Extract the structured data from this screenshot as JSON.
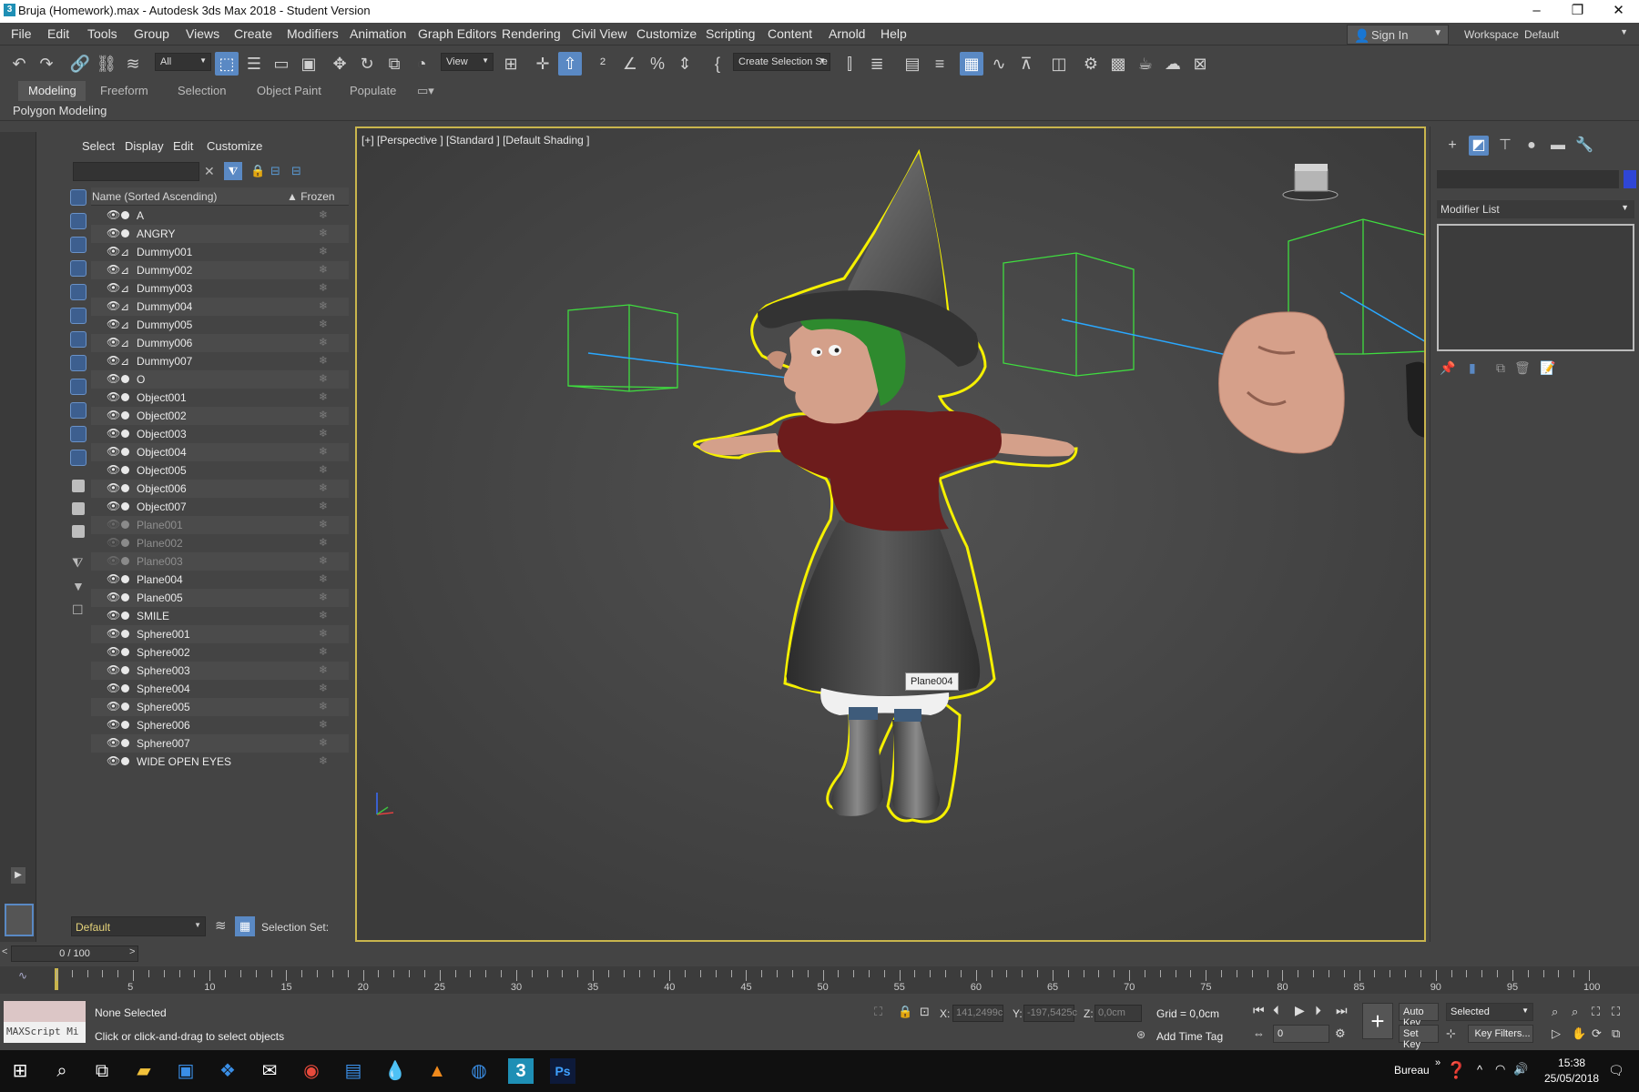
{
  "window": {
    "title": "Bruja (Homework).max - Autodesk 3ds Max 2018 - Student Version",
    "app_icon": "3",
    "controls": [
      "–",
      "❐",
      "✕"
    ]
  },
  "menubar": {
    "items": [
      "File",
      "Edit",
      "Tools",
      "Group",
      "Views",
      "Create",
      "Modifiers",
      "Animation",
      "Graph Editors",
      "Rendering",
      "Civil View",
      "Customize",
      "Scripting",
      "Content",
      "Arnold",
      "Help"
    ],
    "sign_in": "Sign In",
    "workspaces_label": "Workspaces:",
    "workspace_value": "Default"
  },
  "toolbar": {
    "filter_value": "All",
    "refcoord_value": "View",
    "selection_set_value": "Create Selection Se"
  },
  "ribbon": {
    "tabs": [
      "Modeling",
      "Freeform",
      "Selection",
      "Object Paint",
      "Populate"
    ],
    "active_tab": "Modeling",
    "sub_label": "Polygon Modeling"
  },
  "scene_explorer": {
    "menus": [
      "Select",
      "Display",
      "Edit",
      "Customize"
    ],
    "column_name": "Name (Sorted Ascending)",
    "column_frozen": "▲ Frozen",
    "rows": [
      {
        "name": "A",
        "type": "object",
        "dim": false
      },
      {
        "name": "ANGRY",
        "type": "object",
        "dim": false
      },
      {
        "name": "Dummy001",
        "type": "dummy",
        "dim": false
      },
      {
        "name": "Dummy002",
        "type": "dummy",
        "dim": false
      },
      {
        "name": "Dummy003",
        "type": "dummy",
        "dim": false
      },
      {
        "name": "Dummy004",
        "type": "dummy",
        "dim": false
      },
      {
        "name": "Dummy005",
        "type": "dummy",
        "dim": false
      },
      {
        "name": "Dummy006",
        "type": "dummy",
        "dim": false
      },
      {
        "name": "Dummy007",
        "type": "dummy",
        "dim": false
      },
      {
        "name": "O",
        "type": "object",
        "dim": false
      },
      {
        "name": "Object001",
        "type": "object",
        "dim": false
      },
      {
        "name": "Object002",
        "type": "object",
        "dim": false
      },
      {
        "name": "Object003",
        "type": "object",
        "dim": false
      },
      {
        "name": "Object004",
        "type": "object",
        "dim": false
      },
      {
        "name": "Object005",
        "type": "object",
        "dim": false
      },
      {
        "name": "Object006",
        "type": "object",
        "dim": false
      },
      {
        "name": "Object007",
        "type": "object",
        "dim": false
      },
      {
        "name": "Plane001",
        "type": "object",
        "dim": true
      },
      {
        "name": "Plane002",
        "type": "object",
        "dim": true
      },
      {
        "name": "Plane003",
        "type": "object",
        "dim": true
      },
      {
        "name": "Plane004",
        "type": "object",
        "dim": false
      },
      {
        "name": "Plane005",
        "type": "object",
        "dim": false
      },
      {
        "name": "SMILE",
        "type": "object",
        "dim": false
      },
      {
        "name": "Sphere001",
        "type": "object",
        "dim": false
      },
      {
        "name": "Sphere002",
        "type": "object",
        "dim": false
      },
      {
        "name": "Sphere003",
        "type": "object",
        "dim": false
      },
      {
        "name": "Sphere004",
        "type": "object",
        "dim": false
      },
      {
        "name": "Sphere005",
        "type": "object",
        "dim": false
      },
      {
        "name": "Sphere006",
        "type": "object",
        "dim": false
      },
      {
        "name": "Sphere007",
        "type": "object",
        "dim": false
      },
      {
        "name": "WIDE OPEN EYES",
        "type": "object",
        "dim": false
      }
    ],
    "layer_value": "Default",
    "selection_set_label": "Selection Set:"
  },
  "viewport": {
    "label": "[+] [Perspective ] [Standard ] [Default Shading ]",
    "tooltip": "Plane004",
    "selection_color": "#f5f000"
  },
  "command_panel": {
    "modifier_list": "Modifier List",
    "object_color": "#2f46d6"
  },
  "time_slider": {
    "value": "0 / 100",
    "ticks": [
      5,
      10,
      15,
      20,
      25,
      30,
      35,
      40,
      45,
      50,
      55,
      60,
      65,
      70,
      75,
      80,
      85,
      90,
      95,
      100
    ]
  },
  "status": {
    "maxscript": "MAXScript Mi",
    "selection": "None Selected",
    "prompt": "Click or click-and-drag to select objects",
    "x_label": "X:",
    "x_value": "141,2499c",
    "y_label": "Y:",
    "y_value": "-197,5425c",
    "z_label": "Z:",
    "z_value": "0,0cm",
    "grid": "Grid = 0,0cm",
    "add_time_tag": "Add Time Tag",
    "auto_key": "Auto Key",
    "set_key": "Set Key",
    "selected": "Selected",
    "key_filters": "Key Filters...",
    "frame": "0"
  },
  "taskbar": {
    "bureau": "Bureau",
    "time": "15:38",
    "date": "25/05/2018"
  }
}
